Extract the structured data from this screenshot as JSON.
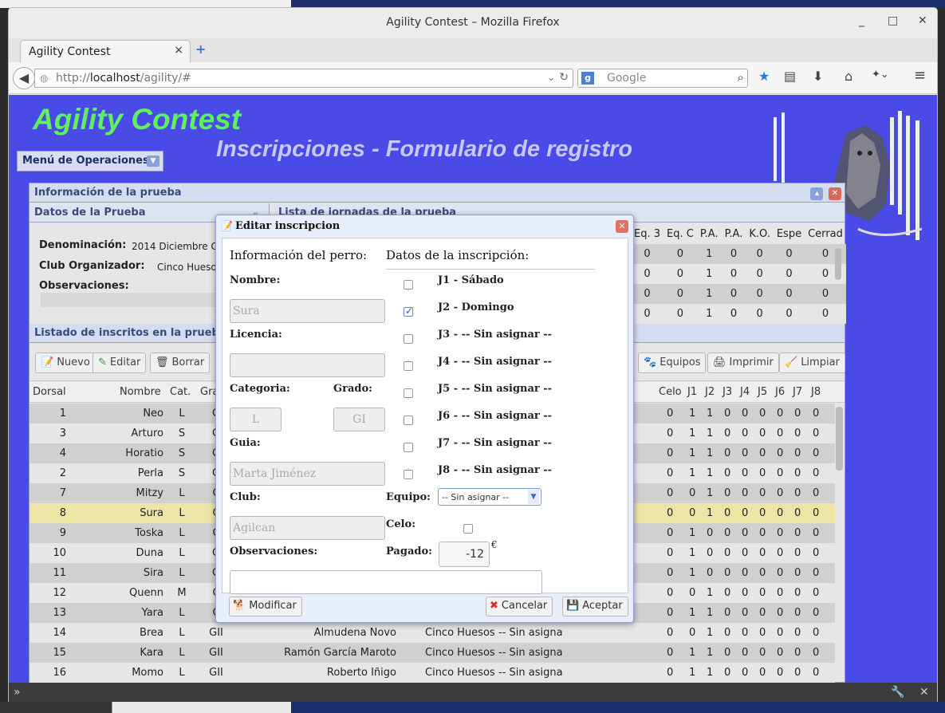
{
  "browser": {
    "window_title": "Agility Contest – Mozilla Firefox",
    "tab_title": "Agility Contest",
    "url_prefix": "http://",
    "url_host": "localhost",
    "url_path": "/agility/#",
    "search_engine": "Google",
    "search_placeholder": "Google"
  },
  "app": {
    "title": "Agility Contest",
    "subtitle": "Inscripciones - Formulario de registro",
    "ops_menu_label": "Menú de Operaciones"
  },
  "panel": {
    "title": "Información de la prueba",
    "datos_title": "Datos de la Prueba",
    "jornadas_title": "Lista de jornadas de la prueba",
    "denominacion_label": "Denominación:",
    "denominacion_value": "2014 Diciembre Ci",
    "club_label": "Club Organizador:",
    "club_value": "Cinco Huesos",
    "observaciones_label": "Observaciones:",
    "jornadas_headers": [
      "Eq. 3",
      "Eq. C",
      "P.A.",
      "P.A.",
      "K.O.",
      "Espe",
      "Cerrad"
    ],
    "jornadas_rows": [
      [
        "0",
        "0",
        "1",
        "0",
        "0",
        "0",
        "0"
      ],
      [
        "0",
        "0",
        "1",
        "0",
        "0",
        "0",
        "0"
      ],
      [
        "0",
        "0",
        "1",
        "0",
        "0",
        "0",
        "0"
      ],
      [
        "0",
        "0",
        "1",
        "0",
        "0",
        "0",
        "0"
      ]
    ]
  },
  "listado": {
    "title": "Listado de inscritos en la prueba",
    "buttons": {
      "nuevo": "Nuevo",
      "editar": "Editar",
      "borrar": "Borrar",
      "equipos": "Equipos",
      "imprimir": "Imprimir",
      "limpiar": "Limpiar"
    },
    "headers": {
      "dorsal": "Dorsal",
      "nombre": "Nombre",
      "cat": "Cat.",
      "grado": "Gra",
      "celo": "Celo",
      "j1": "J1",
      "j2": "J2",
      "j3": "J3",
      "j4": "J4",
      "j5": "J5",
      "j6": "J6",
      "j7": "J7",
      "j8": "J8"
    },
    "rows": [
      {
        "dorsal": "1",
        "nombre": "Neo",
        "cat": "L",
        "grado": "G",
        "guia": "",
        "club": "",
        "equipo": "",
        "celo": "0",
        "j": [
          "1",
          "1",
          "0",
          "0",
          "0",
          "0",
          "0",
          "0"
        ]
      },
      {
        "dorsal": "3",
        "nombre": "Arturo",
        "cat": "S",
        "grado": "G",
        "guia": "",
        "club": "",
        "equipo": "",
        "celo": "0",
        "j": [
          "1",
          "1",
          "0",
          "0",
          "0",
          "0",
          "0",
          "0"
        ]
      },
      {
        "dorsal": "4",
        "nombre": "Horatio",
        "cat": "S",
        "grado": "G",
        "guia": "",
        "club": "",
        "equipo": "",
        "celo": "0",
        "j": [
          "1",
          "1",
          "0",
          "0",
          "0",
          "0",
          "0",
          "0"
        ]
      },
      {
        "dorsal": "2",
        "nombre": "Perla",
        "cat": "S",
        "grado": "G",
        "guia": "",
        "club": "",
        "equipo": "",
        "celo": "0",
        "j": [
          "1",
          "1",
          "0",
          "0",
          "0",
          "0",
          "0",
          "0"
        ]
      },
      {
        "dorsal": "7",
        "nombre": "Mitzy",
        "cat": "L",
        "grado": "C",
        "guia": "",
        "club": "",
        "equipo": "",
        "celo": "0",
        "j": [
          "0",
          "1",
          "0",
          "0",
          "0",
          "0",
          "0",
          "0"
        ]
      },
      {
        "dorsal": "8",
        "nombre": "Sura",
        "cat": "L",
        "grado": "C",
        "guia": "",
        "club": "",
        "equipo": "",
        "celo": "0",
        "j": [
          "0",
          "1",
          "0",
          "0",
          "0",
          "0",
          "0",
          "0"
        ]
      },
      {
        "dorsal": "9",
        "nombre": "Toska",
        "cat": "L",
        "grado": "C",
        "guia": "",
        "club": "",
        "equipo": "",
        "celo": "0",
        "j": [
          "1",
          "0",
          "0",
          "0",
          "0",
          "0",
          "0",
          "0"
        ]
      },
      {
        "dorsal": "10",
        "nombre": "Duna",
        "cat": "L",
        "grado": "G",
        "guia": "",
        "club": "",
        "equipo": "",
        "celo": "0",
        "j": [
          "1",
          "0",
          "0",
          "0",
          "0",
          "0",
          "0",
          "0"
        ]
      },
      {
        "dorsal": "11",
        "nombre": "Sira",
        "cat": "L",
        "grado": "G",
        "guia": "",
        "club": "",
        "equipo": "",
        "celo": "0",
        "j": [
          "1",
          "0",
          "0",
          "0",
          "0",
          "0",
          "0",
          "0"
        ]
      },
      {
        "dorsal": "12",
        "nombre": "Quenn",
        "cat": "M",
        "grado": "C",
        "guia": "",
        "club": "",
        "equipo": "",
        "celo": "0",
        "j": [
          "0",
          "1",
          "0",
          "0",
          "0",
          "0",
          "0",
          "0"
        ]
      },
      {
        "dorsal": "13",
        "nombre": "Yara",
        "cat": "L",
        "grado": "C",
        "guia": "",
        "club": "",
        "equipo": "",
        "celo": "0",
        "j": [
          "1",
          "1",
          "0",
          "0",
          "0",
          "0",
          "0",
          "0"
        ]
      },
      {
        "dorsal": "14",
        "nombre": "Brea",
        "cat": "L",
        "grado": "GII",
        "guia": "Almudena Novo",
        "club": "Cinco Huesos",
        "equipo": "-- Sin asigna",
        "celo": "0",
        "j": [
          "0",
          "1",
          "0",
          "0",
          "0",
          "0",
          "0",
          "0"
        ]
      },
      {
        "dorsal": "15",
        "nombre": "Kara",
        "cat": "L",
        "grado": "GII",
        "guia": "Ramón García Maroto",
        "club": "Cinco Huesos",
        "equipo": "-- Sin asigna",
        "celo": "0",
        "j": [
          "1",
          "1",
          "0",
          "0",
          "0",
          "0",
          "0",
          "0"
        ]
      },
      {
        "dorsal": "16",
        "nombre": "Momo",
        "cat": "L",
        "grado": "GII",
        "guia": "Roberto Iñigo",
        "club": "Cinco Huesos",
        "equipo": "-- Sin asigna",
        "celo": "0",
        "j": [
          "1",
          "1",
          "0",
          "0",
          "0",
          "0",
          "0",
          "0"
        ]
      }
    ]
  },
  "dialog": {
    "title": "Editar inscripcion",
    "perro_heading": "Información del perro:",
    "inscripcion_heading": "Datos de la inscripción:",
    "nombre_label": "Nombre:",
    "nombre_value": "Sura",
    "licencia_label": "Licencia:",
    "licencia_value": "",
    "categoria_label": "Categoria:",
    "categoria_value": "L",
    "grado_label": "Grado:",
    "grado_value": "GI",
    "guia_label": "Guia:",
    "guia_value": "Marta Jiménez",
    "club_label": "Club:",
    "club_value": "Agilcan",
    "observaciones_label": "Observaciones:",
    "jornadas": [
      {
        "label": "J1 - Sábado",
        "checked": false
      },
      {
        "label": "J2 - Domingo",
        "checked": true
      },
      {
        "label": "J3 - -- Sin asignar --",
        "checked": false
      },
      {
        "label": "J4 - -- Sin asignar --",
        "checked": false
      },
      {
        "label": "J5 - -- Sin asignar --",
        "checked": false
      },
      {
        "label": "J6 - -- Sin asignar --",
        "checked": false
      },
      {
        "label": "J7 - -- Sin asignar --",
        "checked": false
      },
      {
        "label": "J8 - -- Sin asignar --",
        "checked": false
      }
    ],
    "equipo_label": "Equipo:",
    "equipo_value": "-- Sin asignar --",
    "celo_label": "Celo:",
    "pagado_label": "Pagado:",
    "pagado_value": "-12",
    "currency": "€",
    "btn_modificar": "Modificar",
    "btn_cancelar": "Cancelar",
    "btn_aceptar": "Aceptar"
  },
  "colors": {
    "page_bg": "#4a4ae6",
    "title_green": "#5ef05e",
    "selected_row": "#ece5a6"
  }
}
